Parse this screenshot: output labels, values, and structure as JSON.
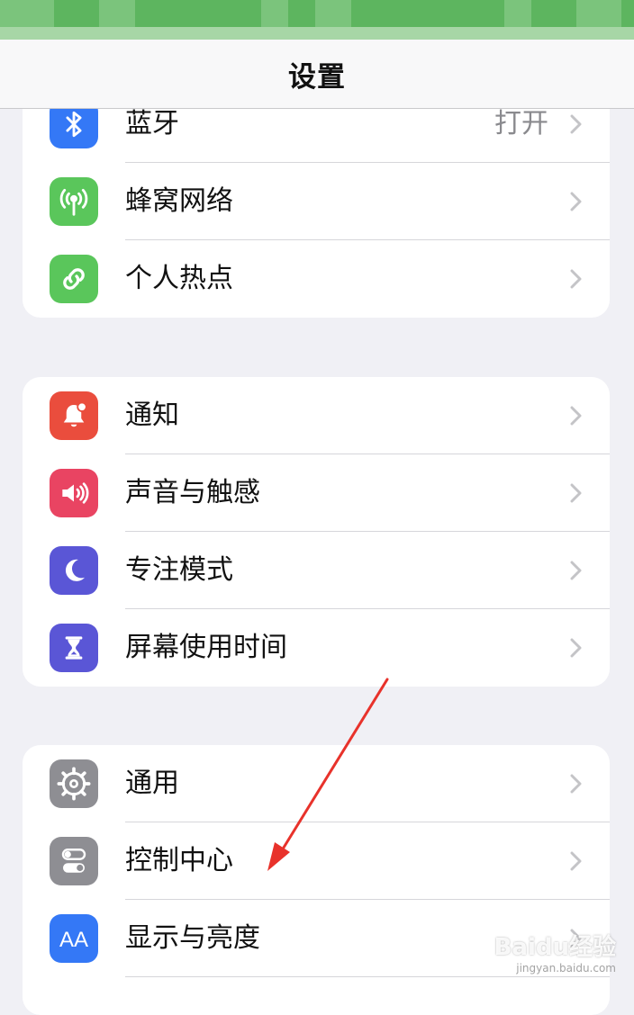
{
  "header": {
    "title": "设置"
  },
  "groups": [
    [
      {
        "label": "蓝牙",
        "value": "打开",
        "icon": "bluetooth-icon",
        "color": "#3478f6"
      },
      {
        "label": "蜂窝网络",
        "icon": "cellular-antenna-icon",
        "color": "#5ac65b"
      },
      {
        "label": "个人热点",
        "icon": "hotspot-link-icon",
        "color": "#5ac65b"
      }
    ],
    [
      {
        "label": "通知",
        "icon": "notification-bell-icon",
        "color": "#ea4d3d"
      },
      {
        "label": "声音与触感",
        "icon": "speaker-icon",
        "color": "#e94462"
      },
      {
        "label": "专注模式",
        "icon": "moon-icon",
        "color": "#5a56d6"
      },
      {
        "label": "屏幕使用时间",
        "icon": "hourglass-icon",
        "color": "#5a56d6"
      }
    ],
    [
      {
        "label": "通用",
        "icon": "gear-icon",
        "color": "#8e8e93"
      },
      {
        "label": "控制中心",
        "icon": "toggle-switches-icon",
        "color": "#8e8e93"
      },
      {
        "label": "显示与亮度",
        "icon": "text-size-aa-icon",
        "color": "#3478f6"
      }
    ]
  ],
  "annotation": {
    "color": "#e8322b",
    "meaning": "arrow pointing to 控制中心"
  },
  "watermark": {
    "logo": "Baidu经验",
    "url": "jingyan.baidu.com"
  }
}
